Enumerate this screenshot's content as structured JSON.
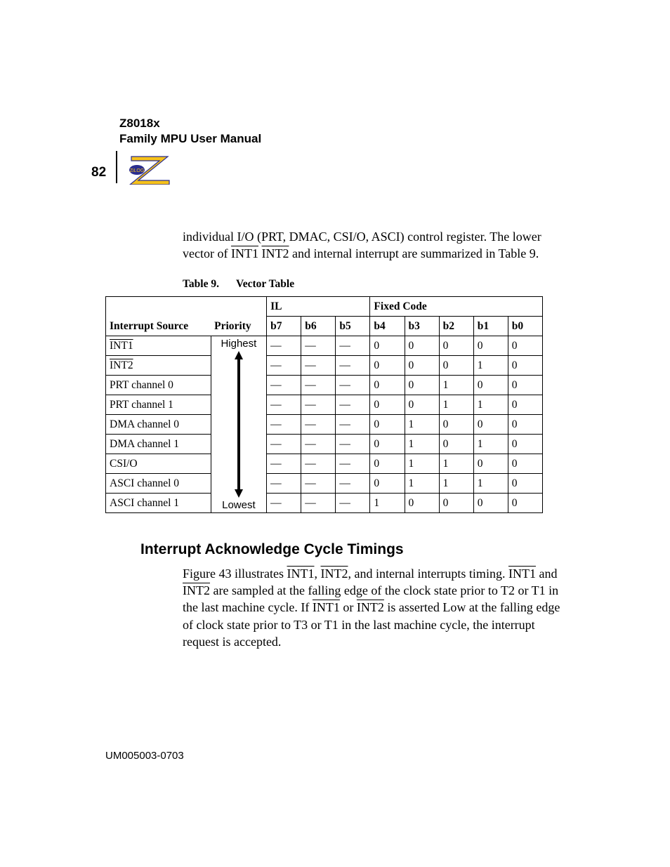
{
  "header": {
    "line1": "Z8018x",
    "line2": "Family MPU User Manual",
    "page_number": "82",
    "logo_badge": "ZiLOG"
  },
  "intro": {
    "prefix": "individual I/O (PRT, DMAC, CSI/O, ASCI) control register. The lower vector of ",
    "int1": "INT1",
    "sep": " ",
    "int2": "INT2",
    "suffix": " and internal interrupt are summarized in Table 9."
  },
  "table_caption": {
    "no": "Table 9.",
    "title": "Vector Table"
  },
  "table_headers": {
    "source": "Interrupt Source",
    "priority": "Priority",
    "il": "IL",
    "fixed": "Fixed Code",
    "b7": "b7",
    "b6": "b6",
    "b5": "b5",
    "b4": "b4",
    "b3": "b3",
    "b2": "b2",
    "b1": "b1",
    "b0": "b0"
  },
  "priority_labels": {
    "high": "Highest",
    "low": "Lowest"
  },
  "rows": [
    {
      "src": "INT1",
      "ov": true,
      "b7": "—",
      "b6": "—",
      "b5": "—",
      "b4": "0",
      "b3": "0",
      "b2": "0",
      "b1": "0",
      "b0": "0"
    },
    {
      "src": "INT2",
      "ov": true,
      "b7": "—",
      "b6": "—",
      "b5": "—",
      "b4": "0",
      "b3": "0",
      "b2": "0",
      "b1": "1",
      "b0": "0"
    },
    {
      "src": "PRT channel 0",
      "ov": false,
      "b7": "—",
      "b6": "—",
      "b5": "—",
      "b4": "0",
      "b3": "0",
      "b2": "1",
      "b1": "0",
      "b0": "0"
    },
    {
      "src": "PRT channel 1",
      "ov": false,
      "b7": "—",
      "b6": "—",
      "b5": "—",
      "b4": "0",
      "b3": "0",
      "b2": "1",
      "b1": "1",
      "b0": "0"
    },
    {
      "src": "DMA channel 0",
      "ov": false,
      "b7": "—",
      "b6": "—",
      "b5": "—",
      "b4": "0",
      "b3": "1",
      "b2": "0",
      "b1": "0",
      "b0": "0"
    },
    {
      "src": "DMA channel 1",
      "ov": false,
      "b7": "—",
      "b6": "—",
      "b5": "—",
      "b4": "0",
      "b3": "1",
      "b2": "0",
      "b1": "1",
      "b0": "0"
    },
    {
      "src": "CSI/O",
      "ov": false,
      "b7": "—",
      "b6": "—",
      "b5": "—",
      "b4": "0",
      "b3": "1",
      "b2": "1",
      "b1": "0",
      "b0": "0"
    },
    {
      "src": "ASCI channel 0",
      "ov": false,
      "b7": "—",
      "b6": "—",
      "b5": "—",
      "b4": "0",
      "b3": "1",
      "b2": "1",
      "b1": "1",
      "b0": "0"
    },
    {
      "src": "ASCI channel 1",
      "ov": false,
      "b7": "—",
      "b6": "—",
      "b5": "—",
      "b4": "1",
      "b3": "0",
      "b2": "0",
      "b1": "0",
      "b0": "0"
    }
  ],
  "section_title": "Interrupt Acknowledge Cycle Timings",
  "para": {
    "p1": "Figure 43 illustrates ",
    "i1": "INT1",
    "c1": ", ",
    "i2": "INT2",
    "c2": ", and internal interrupts timing. ",
    "i3": "INT1",
    "c3": " and ",
    "i4": "INT2",
    "c4": " are sampled at the falling edge of the clock state prior to T2 or T1 in the last machine cycle. If ",
    "i5": "INT1",
    "c5": " or ",
    "i6": "INT2",
    "c6": " is asserted Low at the falling edge of clock state prior to T3 or T1 in the last machine cycle, the interrupt request is accepted."
  },
  "footer": "UM005003-0703"
}
